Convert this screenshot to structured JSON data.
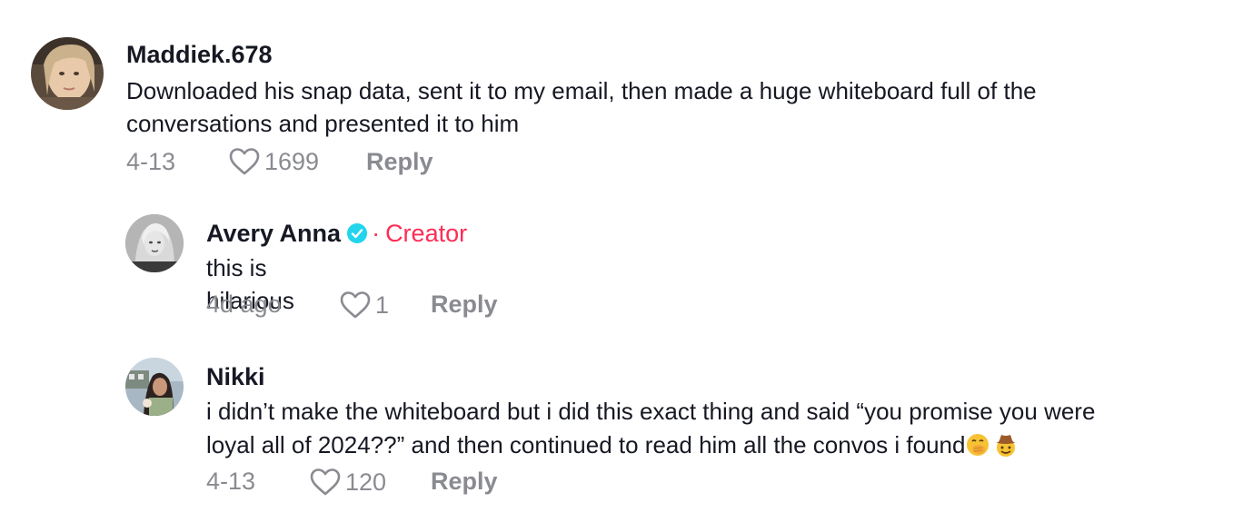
{
  "comments": [
    {
      "username": "Maddiek.678",
      "text": "Downloaded his snap data, sent it to my email, then made a huge whiteboard full of the conversations and presented it to him",
      "date": "4-13",
      "likes": "1699",
      "reply_label": "Reply",
      "avatar_icon": "profile-photo"
    },
    {
      "username": "Avery Anna",
      "verified_icon": "verified-badge-icon",
      "separator": "·",
      "creator_label": "Creator",
      "text": "this is hilarious",
      "date": "4d ago",
      "likes": "1",
      "reply_label": "Reply",
      "avatar_icon": "profile-photo"
    },
    {
      "username": "Nikki",
      "text_line1": "i didn’t make the whiteboard but i did this exact thing and said “you promise you were",
      "text_line2": "loyal all of 2024??” and then continued to read him all the convos i found",
      "emojis": [
        "face-with-hand-over-mouth",
        "cowboy-hat-face"
      ],
      "date": "4-13",
      "likes": "120",
      "reply_label": "Reply",
      "avatar_icon": "profile-photo"
    }
  ],
  "colors": {
    "text": "#161823",
    "muted": "#8a8b91",
    "creator": "#fe2c55",
    "verified": "#20d5ec"
  }
}
